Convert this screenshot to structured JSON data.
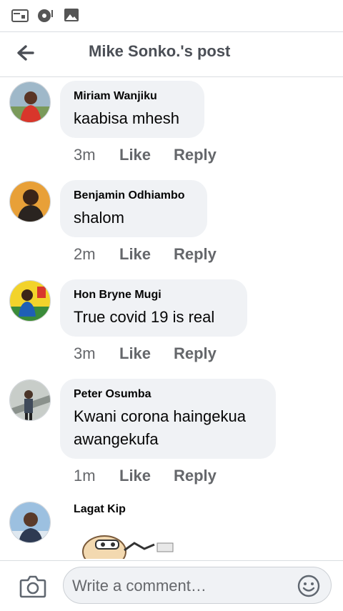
{
  "status_bar": {
    "icons": [
      "calendar-icon",
      "music-disc-icon",
      "image-icon"
    ]
  },
  "header": {
    "back_icon": "arrow-left-icon",
    "title": "Mike Sonko.'s post"
  },
  "comments": [
    {
      "author": "Miriam Wanjiku",
      "text": "kaabisa mhesh",
      "time": "3m",
      "like": "Like",
      "reply": "Reply"
    },
    {
      "author": "Benjamin Odhiambo",
      "text": "shalom",
      "time": "2m",
      "like": "Like",
      "reply": "Reply"
    },
    {
      "author": "Hon Bryne Mugi",
      "text": "True covid 19 is real",
      "time": "3m",
      "like": "Like",
      "reply": "Reply"
    },
    {
      "author": "Peter Osumba",
      "text": "Kwani corona haingekua awangekufa",
      "time": "1m",
      "like": "Like",
      "reply": "Reply"
    },
    {
      "author": "Lagat Kip",
      "text": "",
      "time": "",
      "like": "",
      "reply": ""
    }
  ],
  "composer": {
    "placeholder": "Write a comment…",
    "camera_icon": "camera-icon",
    "emoji_icon": "emoji-icon"
  },
  "colors": {
    "bubble": "#f0f2f5",
    "meta_text": "#65676b",
    "title": "#4b4f56"
  }
}
